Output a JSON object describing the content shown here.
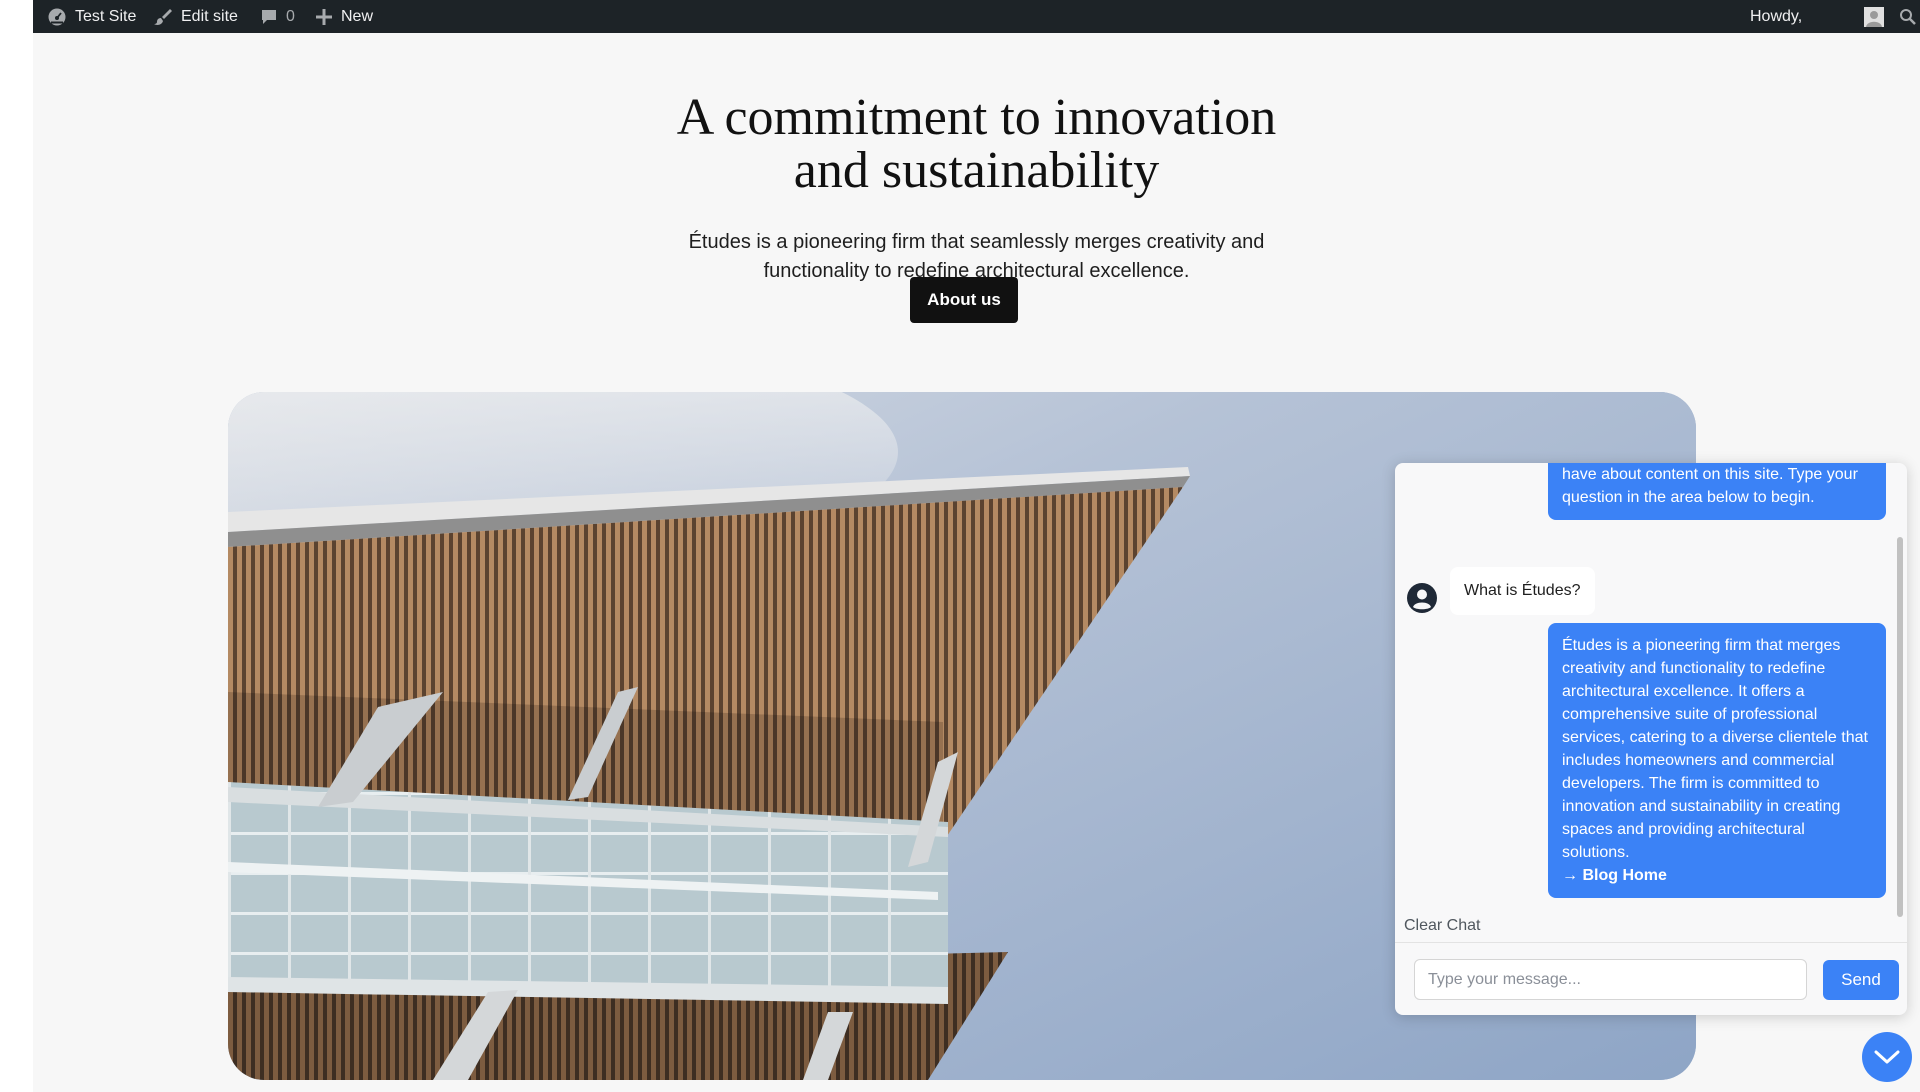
{
  "admin_bar": {
    "site_name": "Test Site",
    "edit_site": "Edit site",
    "comments_count": "0",
    "new_label": "New",
    "howdy": "Howdy,"
  },
  "hero": {
    "title_line1": "A commitment to innovation",
    "title_line2": "and sustainability",
    "text_line1": "Études is a pioneering firm that seamlessly merges creativity and",
    "text_line2": "functionality to redefine architectural excellence.",
    "button_label": "About us"
  },
  "chat": {
    "messages": [
      {
        "role": "bot",
        "text": "have about content on this site. Type your question in the area below to begin."
      },
      {
        "role": "user",
        "text": "What is Études?"
      },
      {
        "role": "bot",
        "text": "Études is a pioneering firm that merges creativity and functionality to redefine architectural excellence. It offers a comprehensive suite of professional services, catering to a diverse clientele that includes homeowners and commercial developers. The firm is committed to innovation and sustainability in creating spaces and providing architectural solutions.",
        "link_label": "→ Blog Home"
      }
    ],
    "clear_label": "Clear Chat",
    "input_placeholder": "Type your message...",
    "send_label": "Send"
  },
  "colors": {
    "accent": "#3b82f6",
    "admin_bar": "#1d2327",
    "button_dark": "#111111"
  },
  "icons": [
    "dashboard-icon",
    "brush-icon",
    "comment-icon",
    "plus-icon",
    "avatar-icon",
    "search-icon",
    "user-circle-icon",
    "chevron-down-icon"
  ]
}
